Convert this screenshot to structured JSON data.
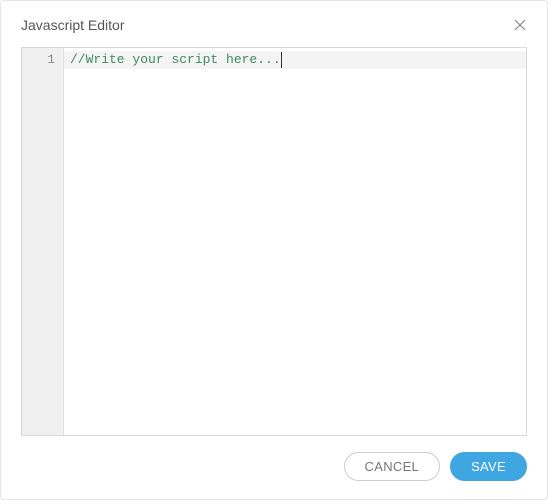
{
  "dialog": {
    "title": "Javascript Editor"
  },
  "editor": {
    "line_numbers": [
      "1"
    ],
    "code": "//Write your script here..."
  },
  "footer": {
    "cancel_label": "CANCEL",
    "save_label": "SAVE"
  }
}
